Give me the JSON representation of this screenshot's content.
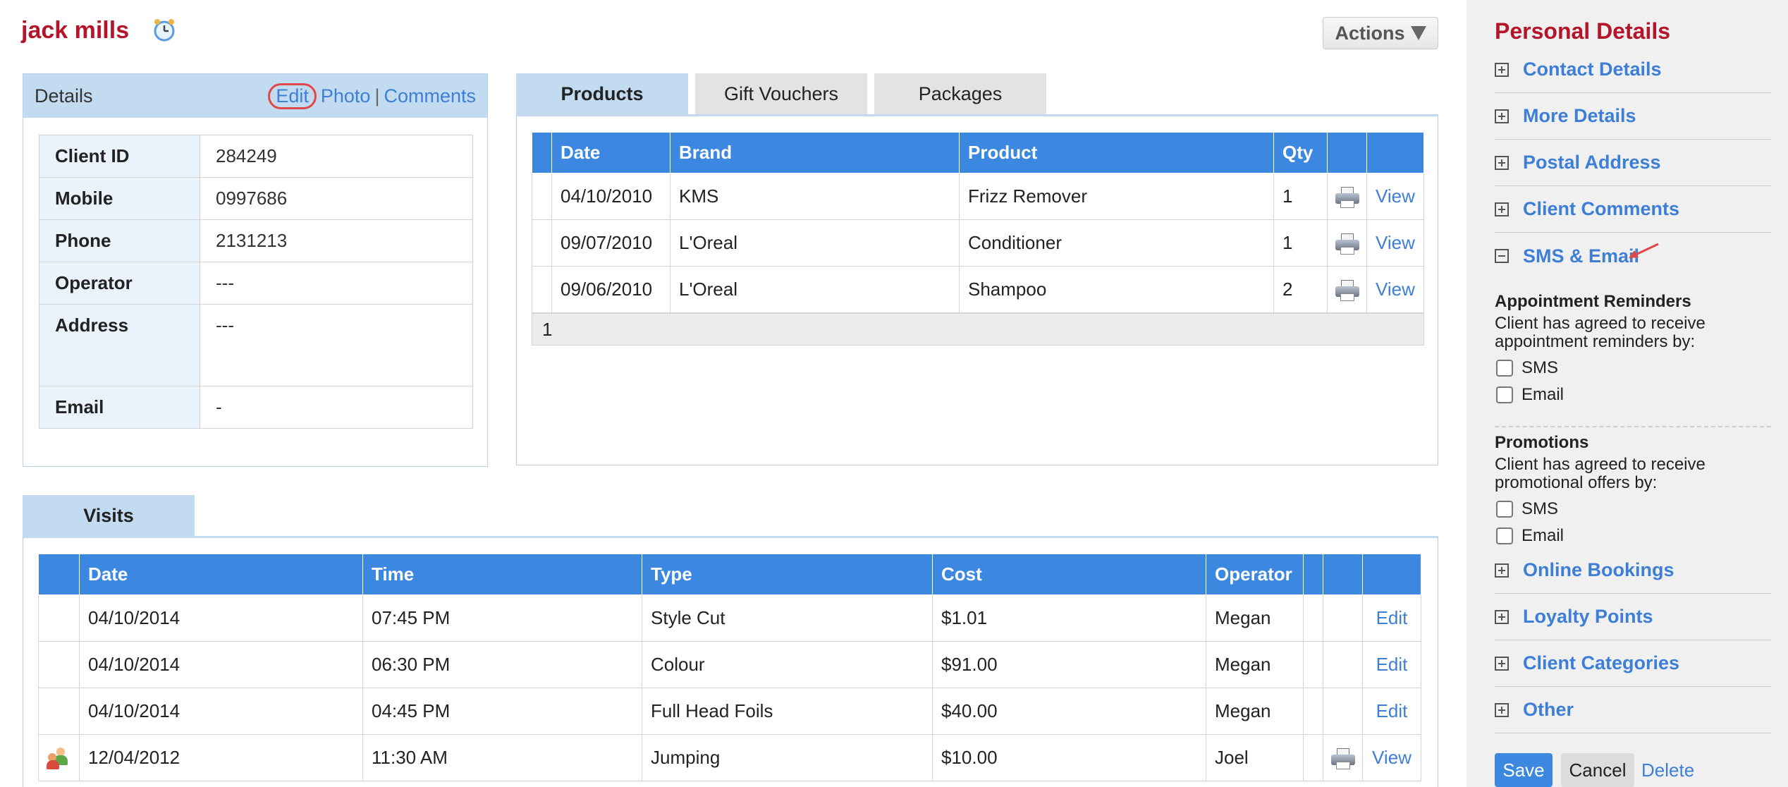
{
  "client": {
    "name": "jack mills"
  },
  "actions_label": "Actions",
  "details": {
    "title": "Details",
    "links": {
      "edit": "Edit",
      "photo": "Photo",
      "separator": "|",
      "comments": "Comments"
    },
    "fields": [
      {
        "label": "Client ID",
        "value": "284249"
      },
      {
        "label": "Mobile",
        "value": "0997686"
      },
      {
        "label": "Phone",
        "value": "2131213"
      },
      {
        "label": "Operator",
        "value": "---"
      },
      {
        "label": "Address",
        "value": "---"
      },
      {
        "label": "Email",
        "value": "-"
      }
    ]
  },
  "products_tabs": [
    {
      "label": "Products",
      "active": true
    },
    {
      "label": "Gift Vouchers",
      "active": false
    },
    {
      "label": "Packages",
      "active": false
    }
  ],
  "products_table": {
    "headers": [
      "",
      "Date",
      "Brand",
      "Product",
      "Qty",
      "",
      ""
    ],
    "rows": [
      {
        "date": "04/10/2010",
        "brand": "KMS",
        "product": "Frizz Remover",
        "qty": "1",
        "action": "View"
      },
      {
        "date": "09/07/2010",
        "brand": "L'Oreal",
        "product": "Conditioner",
        "qty": "1",
        "action": "View"
      },
      {
        "date": "09/06/2010",
        "brand": "L'Oreal",
        "product": "Shampoo",
        "qty": "2",
        "action": "View"
      }
    ],
    "page": "1"
  },
  "visits_tab": {
    "label": "Visits"
  },
  "visits_table": {
    "headers": [
      "",
      "Date",
      "Time",
      "Type",
      "Cost",
      "Operator",
      "",
      "",
      ""
    ],
    "rows": [
      {
        "date": "04/10/2014",
        "time": "07:45 PM",
        "type": "Style Cut",
        "cost": "$1.01",
        "operator": "Megan",
        "action": "Edit"
      },
      {
        "date": "04/10/2014",
        "time": "06:30 PM",
        "type": "Colour",
        "cost": "$91.00",
        "operator": "Megan",
        "action": "Edit"
      },
      {
        "date": "04/10/2014",
        "time": "04:45 PM",
        "type": "Full Head Foils",
        "cost": "$40.00",
        "operator": "Megan",
        "action": "Edit"
      },
      {
        "date": "12/04/2012",
        "time": "11:30 AM",
        "type": "Jumping",
        "cost": "$10.00",
        "operator": "Joel",
        "action": "View"
      }
    ]
  },
  "sidebar": {
    "title": "Personal Details",
    "sections_top": [
      "Contact Details",
      "More Details",
      "Postal Address",
      "Client Comments",
      "SMS & Email"
    ],
    "sections_bottom": [
      "Online Bookings",
      "Loyalty Points",
      "Client Categories",
      "Other"
    ],
    "appointment": {
      "title": "Appointment Reminders",
      "desc": "Client has agreed to receive appointment reminders by:",
      "options": [
        "SMS",
        "Email"
      ]
    },
    "promotions": {
      "title": "Promotions",
      "desc": "Client has agreed to receive promotional offers by:",
      "options": [
        "SMS",
        "Email"
      ]
    },
    "buttons": {
      "save": "Save",
      "cancel": "Cancel",
      "delete": "Delete"
    }
  },
  "colors": {
    "title_red": "#b5152b",
    "link_blue": "#3d7fd6",
    "header_blue": "#3c88e0",
    "panel_blue": "#c2dbf0"
  }
}
